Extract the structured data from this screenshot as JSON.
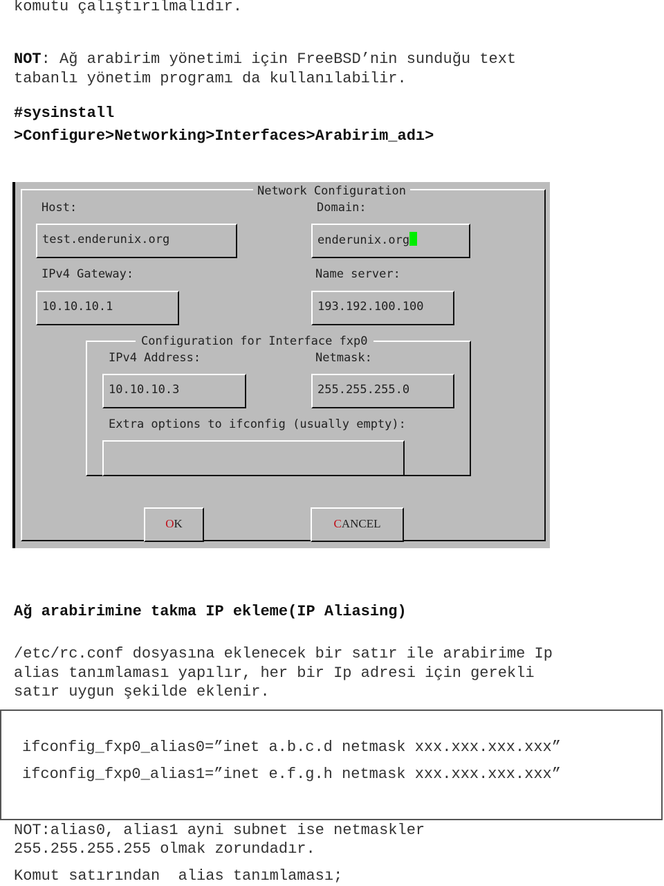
{
  "document": {
    "intro_line": "komutu çalıştırılmalıdır.",
    "note1_label": "NOT",
    "note1_text": ": Ağ arabirim yönetimi için FreeBSD’nin sunduğu text",
    "note1_text2": "tabanlı yönetim programı da kullanılabilir.",
    "command": "#sysinstall",
    "menu_path": ">Configure>Networking>Interfaces>Arabirim_adı>",
    "section_heading": "Ağ arabirimine takma IP ekleme(IP Aliasing)",
    "para_lines": [
      "/etc/rc.conf dosyasına eklenecek bir satır ile arabirime Ip",
      "alias tanımlaması yapılır, her bir Ip adresi için gerekli",
      "satır uygun şekilde eklenir."
    ],
    "code_lines": [
      "ifconfig_fxp0_alias0=”inet a.b.c.d netmask xxx.xxx.xxx.xxx”",
      "ifconfig_fxp0_alias1=”inet e.f.g.h netmask xxx.xxx.xxx.xxx”"
    ],
    "note2_lines": [
      "NOT:alias0, alias1 ayni subnet ise netmaskler",
      "255.255.255.255 olmak zorundadır."
    ],
    "last_line": "Komut satırından  alias tanımlaması;"
  },
  "dialog": {
    "title": "Network Configuration",
    "host_label": "Host:",
    "host_value": "test.enderunix.org",
    "domain_label": "Domain:",
    "domain_value": "enderunix.org",
    "gateway_label": "IPv4 Gateway:",
    "gateway_value": "10.10.10.1",
    "nameserver_label": "Name server:",
    "nameserver_value": "193.192.100.100",
    "iface_title": "Configuration for Interface fxp0",
    "ipv4_label": "IPv4 Address:",
    "ipv4_value": "10.10.10.3",
    "netmask_label": "Netmask:",
    "netmask_value": "255.255.255.0",
    "extra_label": "Extra options to ifconfig (usually empty):",
    "extra_value": "",
    "ok_hotkey": "O",
    "ok_rest": "K",
    "cancel_hotkey": "C",
    "cancel_rest": "ANCEL",
    "colors": {
      "panel": "#bcbcbc",
      "cursor": "#00ee00",
      "hotkey": "#c0101a"
    }
  }
}
